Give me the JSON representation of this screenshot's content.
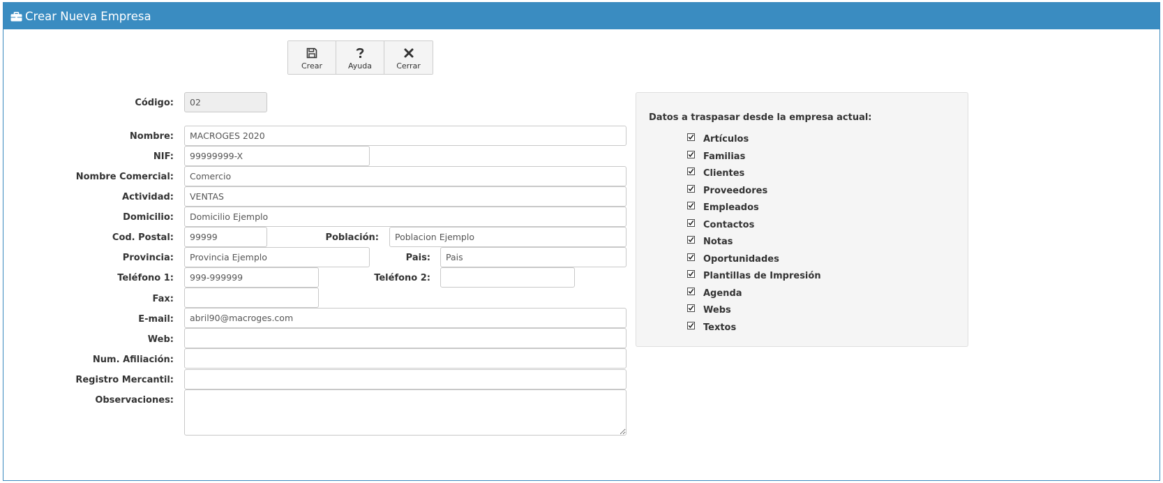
{
  "window": {
    "title": "Crear Nueva Empresa",
    "title_icon": "briefcase-icon"
  },
  "toolbar": [
    {
      "name": "crear-button",
      "label": "Crear",
      "icon": "save-icon"
    },
    {
      "name": "ayuda-button",
      "label": "Ayuda",
      "icon": "question-icon"
    },
    {
      "name": "cerrar-button",
      "label": "Cerrar",
      "icon": "close-icon"
    }
  ],
  "form": {
    "codigo": {
      "label": "Código:",
      "value": "02"
    },
    "nombre": {
      "label": "Nombre:",
      "value": "MACROGES 2020"
    },
    "nif": {
      "label": "NIF:",
      "value": "99999999-X"
    },
    "nombre_comercial": {
      "label": "Nombre Comercial:",
      "value": "Comercio"
    },
    "actividad": {
      "label": "Actividad:",
      "value": "VENTAS"
    },
    "domicilio": {
      "label": "Domicilio:",
      "value": "Domicilio Ejemplo"
    },
    "cod_postal": {
      "label": "Cod. Postal:",
      "value": "99999"
    },
    "poblacion": {
      "label": "Población:",
      "value": "Poblacion Ejemplo"
    },
    "provincia": {
      "label": "Provincia:",
      "value": "Provincia Ejemplo"
    },
    "pais": {
      "label": "Pais:",
      "value": "Pais"
    },
    "telefono1": {
      "label": "Teléfono 1:",
      "value": "999-999999"
    },
    "telefono2": {
      "label": "Teléfono 2:",
      "value": ""
    },
    "fax": {
      "label": "Fax:",
      "value": ""
    },
    "email": {
      "label": "E-mail:",
      "value": "abril90@macroges.com"
    },
    "web": {
      "label": "Web:",
      "value": ""
    },
    "num_afiliacion": {
      "label": "Num. Afiliación:",
      "value": ""
    },
    "registro_mercantil": {
      "label": "Registro Mercantil:",
      "value": ""
    },
    "observaciones": {
      "label": "Observaciones:",
      "value": ""
    }
  },
  "transfer": {
    "title": "Datos a traspasar desde la empresa actual:",
    "items": [
      {
        "label": "Artículos",
        "checked": true
      },
      {
        "label": "Familias",
        "checked": true
      },
      {
        "label": "Clientes",
        "checked": true
      },
      {
        "label": "Proveedores",
        "checked": true
      },
      {
        "label": "Empleados",
        "checked": true
      },
      {
        "label": "Contactos",
        "checked": true
      },
      {
        "label": "Notas",
        "checked": true
      },
      {
        "label": "Oportunidades",
        "checked": true
      },
      {
        "label": "Plantillas de Impresión",
        "checked": true
      },
      {
        "label": "Agenda",
        "checked": true
      },
      {
        "label": "Webs",
        "checked": true
      },
      {
        "label": "Textos",
        "checked": true
      }
    ]
  },
  "colors": {
    "header": "#3a8cc1",
    "panel": "#f5f5f5",
    "readonly": "#eeeeee"
  }
}
